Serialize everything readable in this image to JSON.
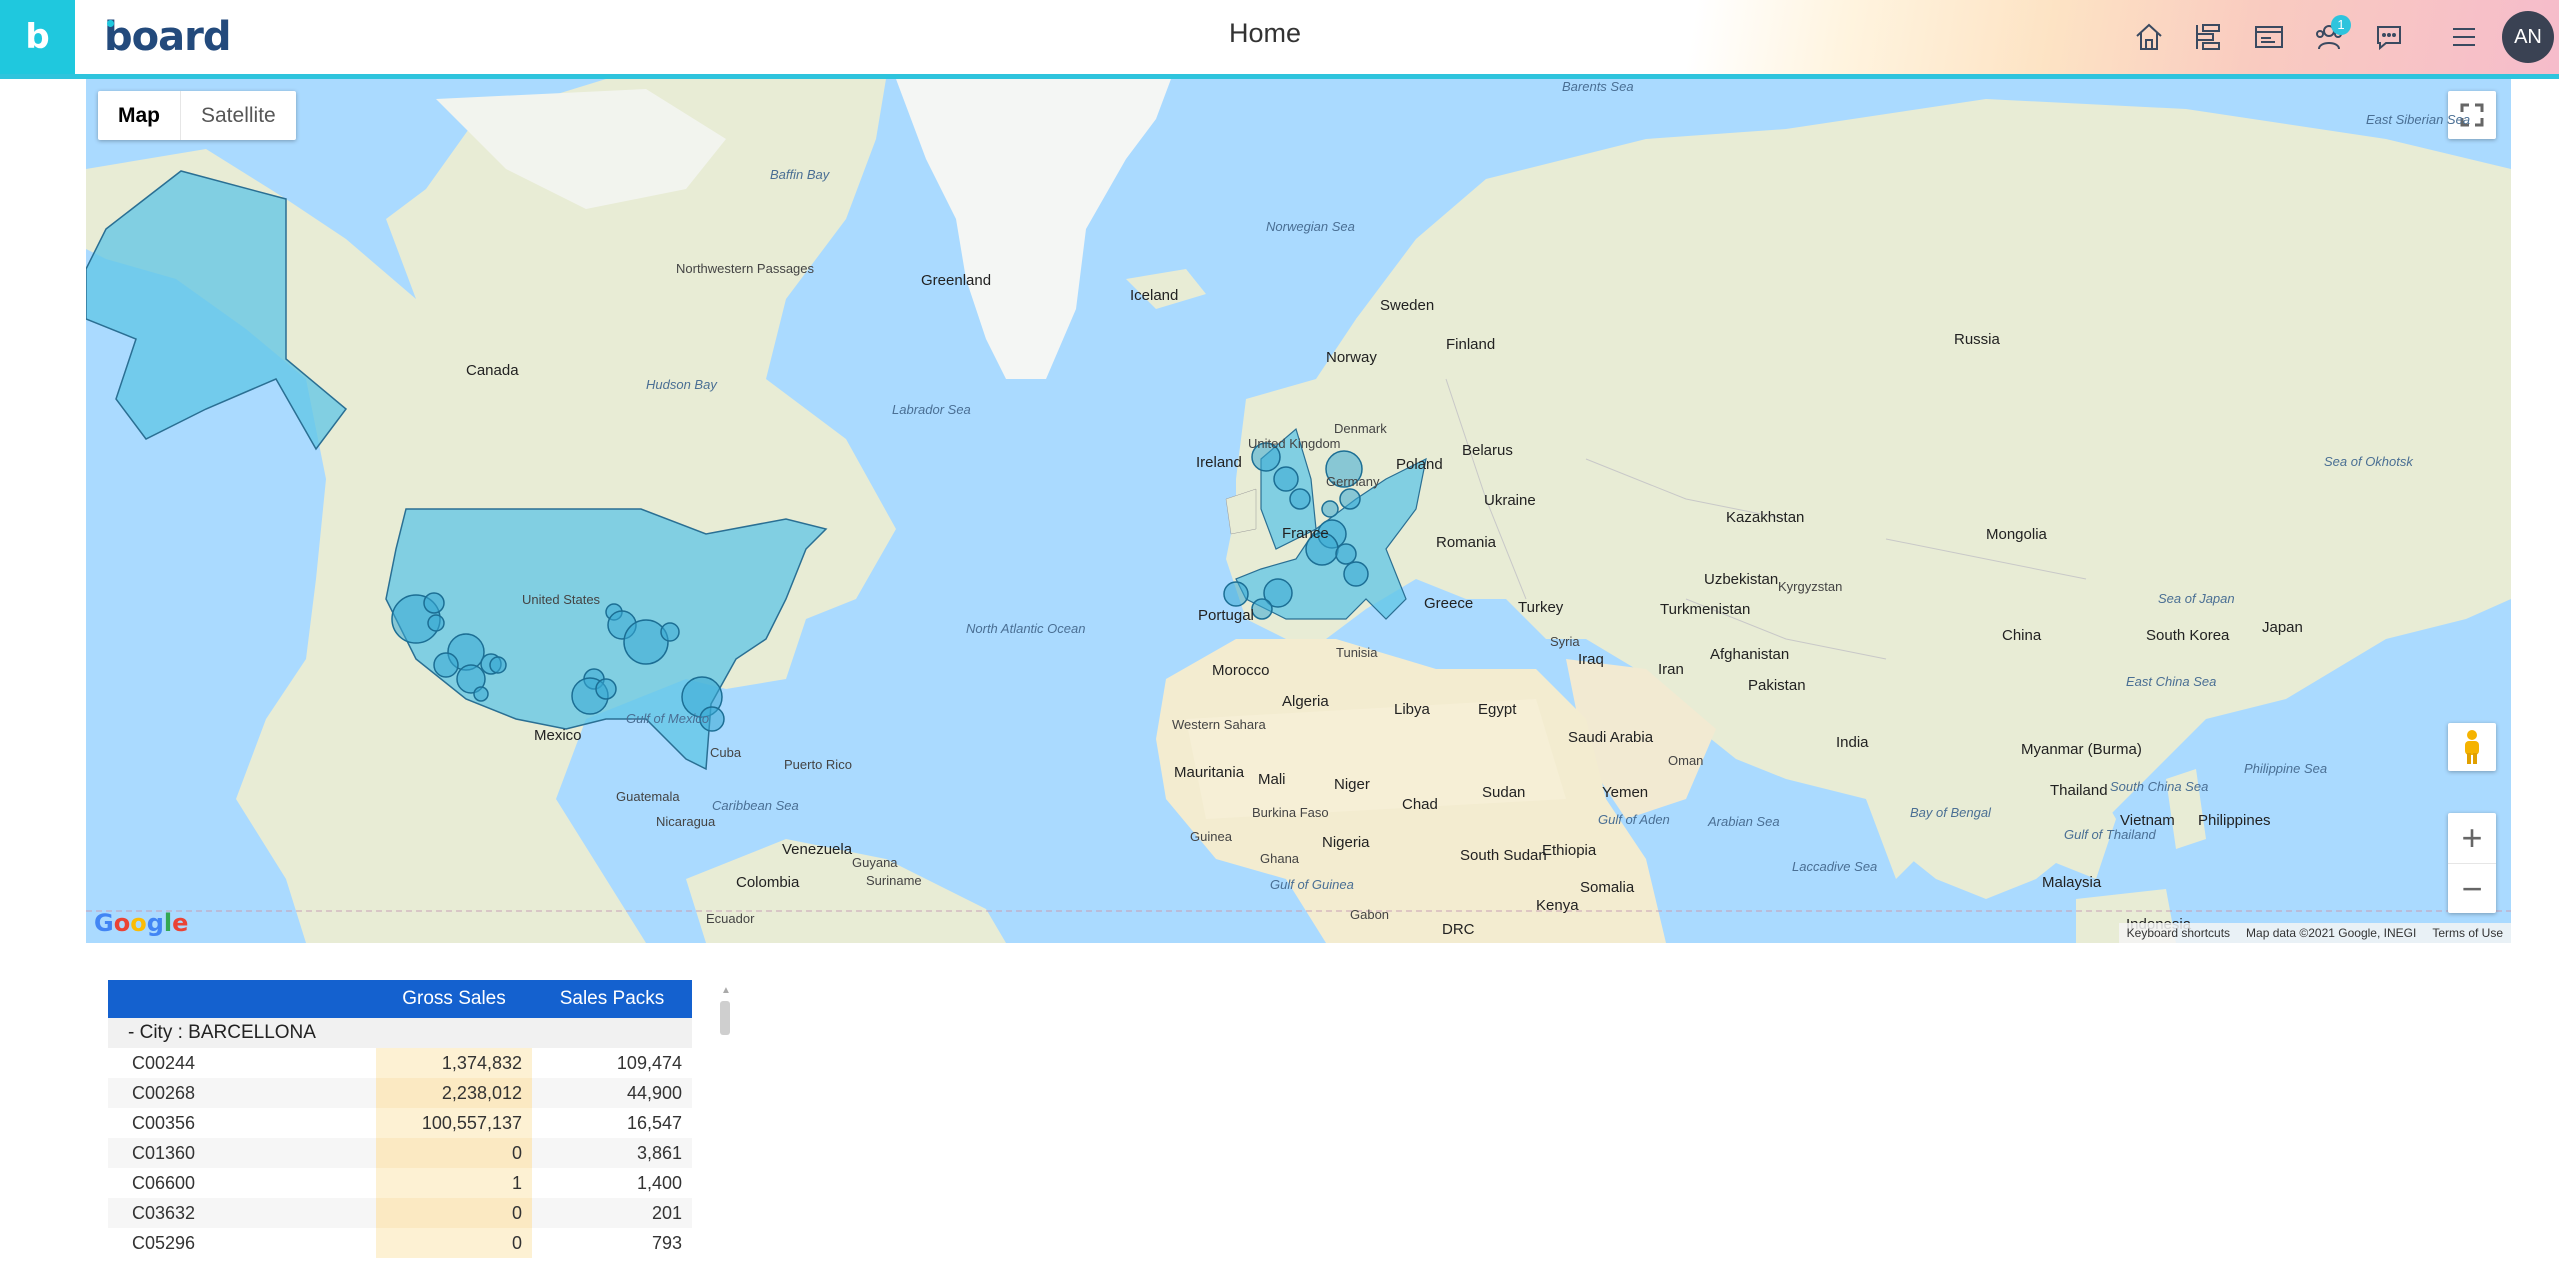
{
  "header": {
    "logo_letter": "b",
    "brand": "board",
    "title": "Home",
    "notification_count": "1",
    "avatar_initials": "AN",
    "icons": [
      "home-icon",
      "dashboard-icon",
      "presentation-icon",
      "users-icon",
      "chat-icon",
      "menu-icon"
    ]
  },
  "map": {
    "type_options": [
      "Map",
      "Satellite"
    ],
    "selected_type": "Map",
    "attribution_keyboard": "Keyboard shortcuts",
    "attribution_data": "Map data ©2021 Google, INEGI",
    "attribution_terms": "Terms of Use",
    "google_logo": "Google",
    "labels": {
      "greenland": "Greenland",
      "iceland": "Iceland",
      "canada": "Canada",
      "russia": "Russia",
      "sweden": "Sweden",
      "finland": "Finland",
      "norway": "Norway",
      "denmark": "Denmark",
      "ireland": "Ireland",
      "united_kingdom": "United Kingdom",
      "germany": "Germany",
      "poland": "Poland",
      "belarus": "Belarus",
      "ukraine": "Ukraine",
      "france": "France",
      "romania": "Romania",
      "portugal": "Portugal",
      "greece": "Greece",
      "turkey": "Turkey",
      "kazakhstan": "Kazakhstan",
      "mongolia": "Mongolia",
      "uzbekistan": "Uzbekistan",
      "kyrgyzstan": "Kyrgyzstan",
      "turkmenistan": "Turkmenistan",
      "afghanistan": "Afghanistan",
      "iran": "Iran",
      "iraq": "Iraq",
      "syria": "Syria",
      "pakistan": "Pakistan",
      "china": "China",
      "south_korea": "South Korea",
      "japan": "Japan",
      "india": "India",
      "myanmar": "Myanmar (Burma)",
      "thailand": "Thailand",
      "vietnam": "Vietnam",
      "philippines": "Philippines",
      "malaysia": "Malaysia",
      "indonesia": "Indonesia",
      "morocco": "Morocco",
      "algeria": "Algeria",
      "tunisia": "Tunisia",
      "libya": "Libya",
      "egypt": "Egypt",
      "western_sahara": "Western Sahara",
      "mauritania": "Mauritania",
      "mali": "Mali",
      "niger": "Niger",
      "chad": "Chad",
      "sudan": "Sudan",
      "south_sudan": "South Sudan",
      "ethiopia": "Ethiopia",
      "nigeria": "Nigeria",
      "ghana": "Ghana",
      "guinea": "Guinea",
      "burkina_faso": "Burkina Faso",
      "gabon": "Gabon",
      "drc": "DRC",
      "kenya": "Kenya",
      "somalia": "Somalia",
      "saudi_arabia": "Saudi Arabia",
      "yemen": "Yemen",
      "oman": "Oman",
      "united_states": "United States",
      "mexico": "Mexico",
      "cuba": "Cuba",
      "puerto_rico": "Puerto Rico",
      "guatemala": "Guatemala",
      "nicaragua": "Nicaragua",
      "venezuela": "Venezuela",
      "colombia": "Colombia",
      "ecuador": "Ecuador",
      "guyana": "Guyana",
      "suriname": "Suriname",
      "baffin_bay": "Baffin Bay",
      "hudson_bay": "Hudson Bay",
      "labrador_sea": "Labrador Sea",
      "norwegian_sea": "Norwegian Sea",
      "barents_sea": "Barents Sea",
      "north_atlantic_ocean": "North Atlantic Ocean",
      "gulf_of_mexico": "Gulf of Mexico",
      "caribbean_sea": "Caribbean Sea",
      "arabian_sea": "Arabian Sea",
      "bay_of_bengal": "Bay of Bengal",
      "laccadive_sea": "Laccadive Sea",
      "sea_of_japan": "Sea of Japan",
      "east_china_sea": "East China Sea",
      "philippine_sea": "Philippine Sea",
      "south_china_sea": "South China Sea",
      "gulf_of_guinea": "Gulf of Guinea",
      "gulf_of_aden": "Gulf of Aden",
      "sea_of_okhotsk": "Sea of Okhotsk",
      "east_siberian_sea": "East Siberian Sea",
      "gulf_of_thailand": "Gulf of Thailand",
      "northwest_passages": "Northwestern Passages"
    }
  },
  "table": {
    "columns": [
      "Gross Sales",
      "Sales Packs"
    ],
    "group_label": "-  City : BARCELLONA",
    "rows": [
      {
        "name": "C00244",
        "gross_sales": "1,374,832",
        "sales_packs": "109,474"
      },
      {
        "name": "C00268",
        "gross_sales": "2,238,012",
        "sales_packs": "44,900"
      },
      {
        "name": "C00356",
        "gross_sales": "100,557,137",
        "sales_packs": "16,547"
      },
      {
        "name": "C01360",
        "gross_sales": "0",
        "sales_packs": "3,861"
      },
      {
        "name": "C06600",
        "gross_sales": "1",
        "sales_packs": "1,400"
      },
      {
        "name": "C03632",
        "gross_sales": "0",
        "sales_packs": "201"
      },
      {
        "name": "C05296",
        "gross_sales": "0",
        "sales_packs": "793"
      }
    ]
  },
  "colors": {
    "accent": "#2ec4dd",
    "table_header": "#1461cf",
    "gross_sales_cell": "#fdf1d3",
    "highlight_region": "#5fc6e6",
    "ocean": "#aadaff",
    "land": "#e8ecd5"
  }
}
